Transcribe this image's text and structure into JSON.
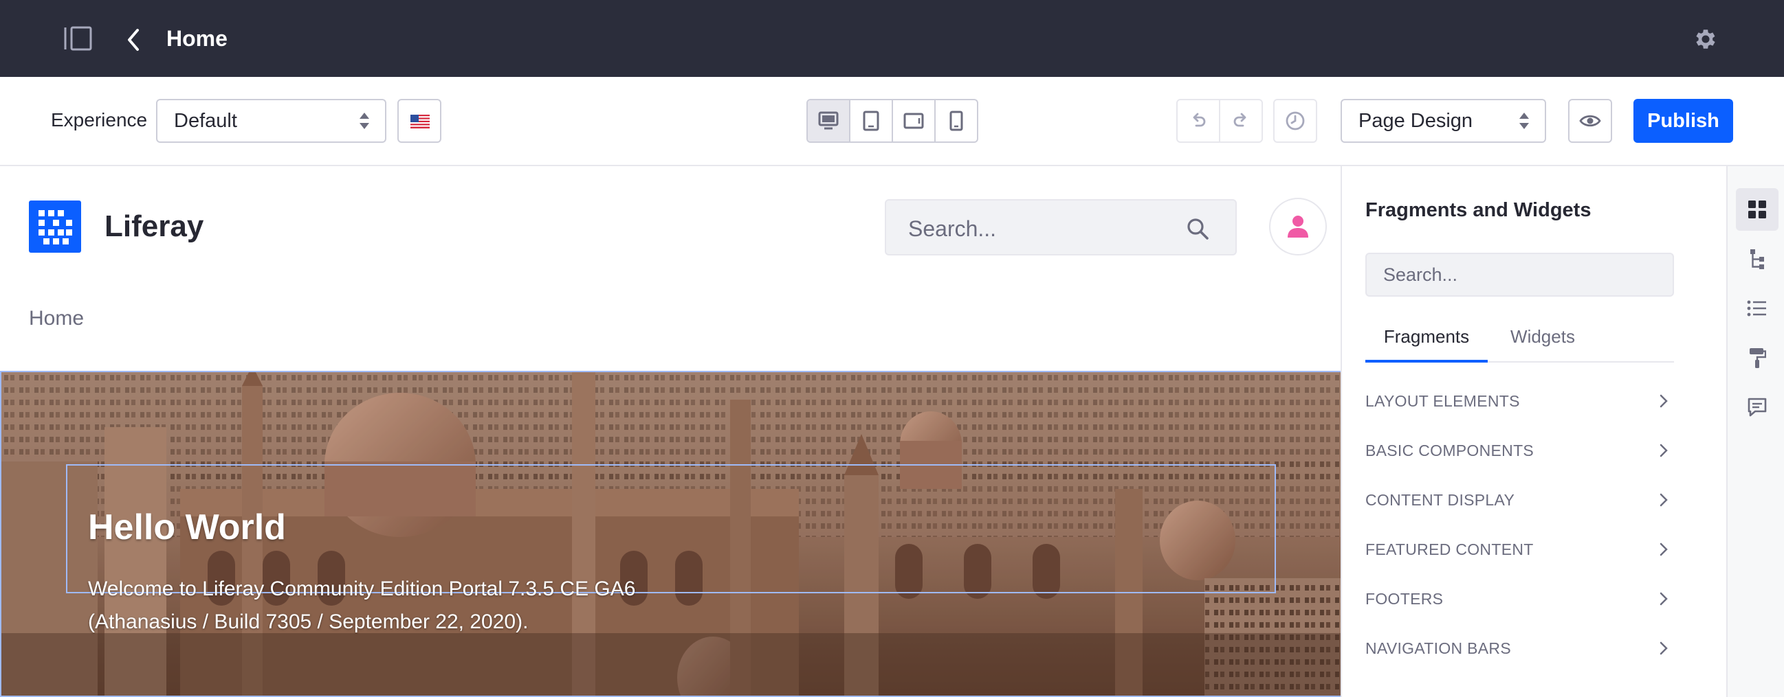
{
  "header": {
    "title": "Home"
  },
  "toolbar": {
    "experience_label": "Experience",
    "experience_value": "Default",
    "page_design_value": "Page Design",
    "publish_label": "Publish"
  },
  "site": {
    "name": "Liferay",
    "search_placeholder": "Search...",
    "nav_item": "Home"
  },
  "hero": {
    "title": "Hello World",
    "line1": "Welcome to Liferay Community Edition Portal 7.3.5 CE GA6",
    "line2": "(Athanasius / Build 7305 / September 22, 2020)."
  },
  "panel": {
    "title": "Fragments and Widgets",
    "search_placeholder": "Search...",
    "tabs": [
      {
        "label": "Fragments",
        "active": true
      },
      {
        "label": "Widgets",
        "active": false
      }
    ],
    "categories": [
      "LAYOUT ELEMENTS",
      "BASIC COMPONENTS",
      "CONTENT DISPLAY",
      "FEATURED CONTENT",
      "FOOTERS",
      "NAVIGATION BARS"
    ]
  },
  "colors": {
    "topbar": "#2b2d3b",
    "primary": "#0b5fff",
    "avatar": "#f05aa5",
    "selection": "#9fbaf7"
  },
  "icons": {
    "topbar": [
      "sidebar-toggle-icon",
      "angle-left-icon",
      "cog-icon"
    ],
    "devices": [
      "desktop-icon",
      "tablet-portrait-icon",
      "tablet-landscape-icon",
      "mobile-icon"
    ],
    "rail": [
      "fragments-grid-icon",
      "page-structure-icon",
      "list-icon",
      "paint-roller-icon",
      "comments-icon"
    ]
  }
}
